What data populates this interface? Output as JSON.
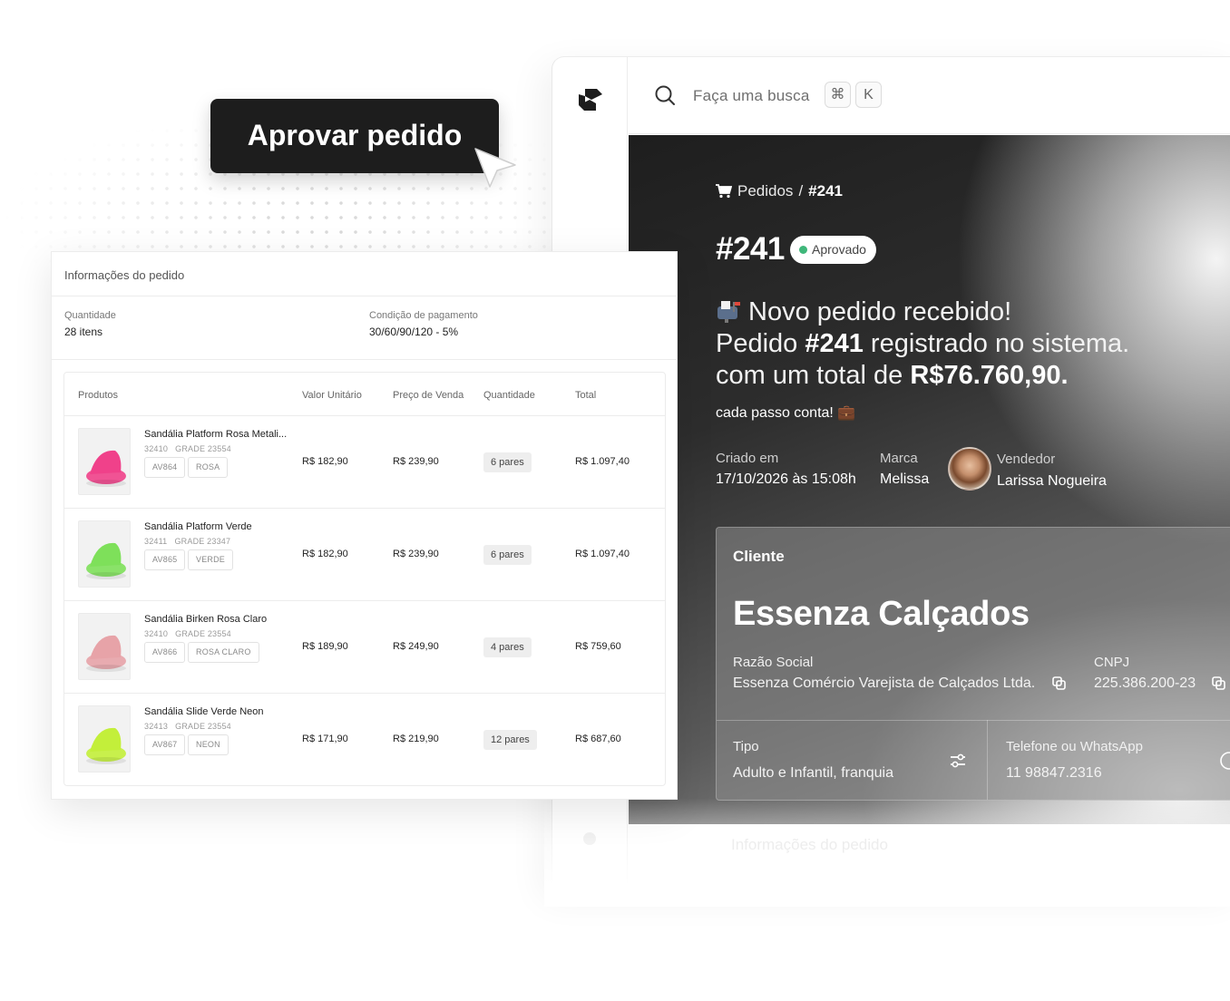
{
  "cta": {
    "label": "Aprovar pedido"
  },
  "topbar": {
    "search_placeholder": "Faça uma busca",
    "shortcut_key1": "⌘",
    "shortcut_key2": "K"
  },
  "hero": {
    "breadcrumb_root": "Pedidos",
    "breadcrumb_sep": "/",
    "breadcrumb_current": "#241",
    "order_number": "#241",
    "status": "Aprovado",
    "status_color": "#3fb77a",
    "headline_line1": "Novo pedido recebido!",
    "headline_line2_a": "Pedido ",
    "headline_line2_b": "#241",
    "headline_line2_c": " registrado no sistema.",
    "headline_line3_a": "com um total de ",
    "headline_line3_b": "R$76.760,90.",
    "tagline": "cada passo conta! 💼",
    "created_label": "Criado em",
    "created_value": "17/10/2026 às 15:08h",
    "brand_label": "Marca",
    "brand_value": "Melissa",
    "seller_label": "Vendedor",
    "seller_value": "Larissa Nogueira"
  },
  "client": {
    "title": "Cliente",
    "name": "Essenza Calçados",
    "razao_label": "Razão Social",
    "razao_value": "Essenza Comércio Varejista de Calçados Ltda.",
    "cnpj_label": "CNPJ",
    "cnpj_value": "225.386.200-23",
    "tipo_label": "Tipo",
    "tipo_value": "Adulto e Infantil, franquia",
    "phone_label": "Telefone ou WhatsApp",
    "phone_value": "11 98847.2316"
  },
  "ghost_section": "Informações do pedido",
  "order_panel": {
    "title": "Informações do pedido",
    "qty_label": "Quantidade",
    "qty_value": "28 itens",
    "payment_label": "Condição de pagamento",
    "payment_value": "30/60/90/120 - 5%",
    "columns": [
      "Produtos",
      "Valor Unitário",
      "Preço de Venda",
      "Quantidade",
      "Total"
    ],
    "rows": [
      {
        "name": "Sandália Platform Rosa Metali...",
        "ref": "32410",
        "grade": "GRADE 23554",
        "tags": [
          "AV864",
          "ROSA"
        ],
        "unit": "R$ 182,90",
        "sale": "R$ 239,90",
        "qty": "6 pares",
        "total": "R$ 1.097,40",
        "color": "#f0418a"
      },
      {
        "name": "Sandália Platform Verde",
        "ref": "32411",
        "grade": "GRADE 23347",
        "tags": [
          "AV865",
          "VERDE"
        ],
        "unit": "R$ 182,90",
        "sale": "R$ 239,90",
        "qty": "6 pares",
        "total": "R$ 1.097,40",
        "color": "#7ee05a"
      },
      {
        "name": "Sandália Birken Rosa Claro",
        "ref": "32410",
        "grade": "GRADE 23554",
        "tags": [
          "AV866",
          "ROSA CLARO"
        ],
        "unit": "R$ 189,90",
        "sale": "R$ 249,90",
        "qty": "4 pares",
        "total": "R$ 759,60",
        "color": "#e7a3a8"
      },
      {
        "name": "Sandália Slide Verde Neon",
        "ref": "32413",
        "grade": "GRADE 23554",
        "tags": [
          "AV867",
          "NEON"
        ],
        "unit": "R$ 171,90",
        "sale": "R$ 219,90",
        "qty": "12 pares",
        "total": "R$ 687,60",
        "color": "#c3ef3a"
      }
    ]
  }
}
